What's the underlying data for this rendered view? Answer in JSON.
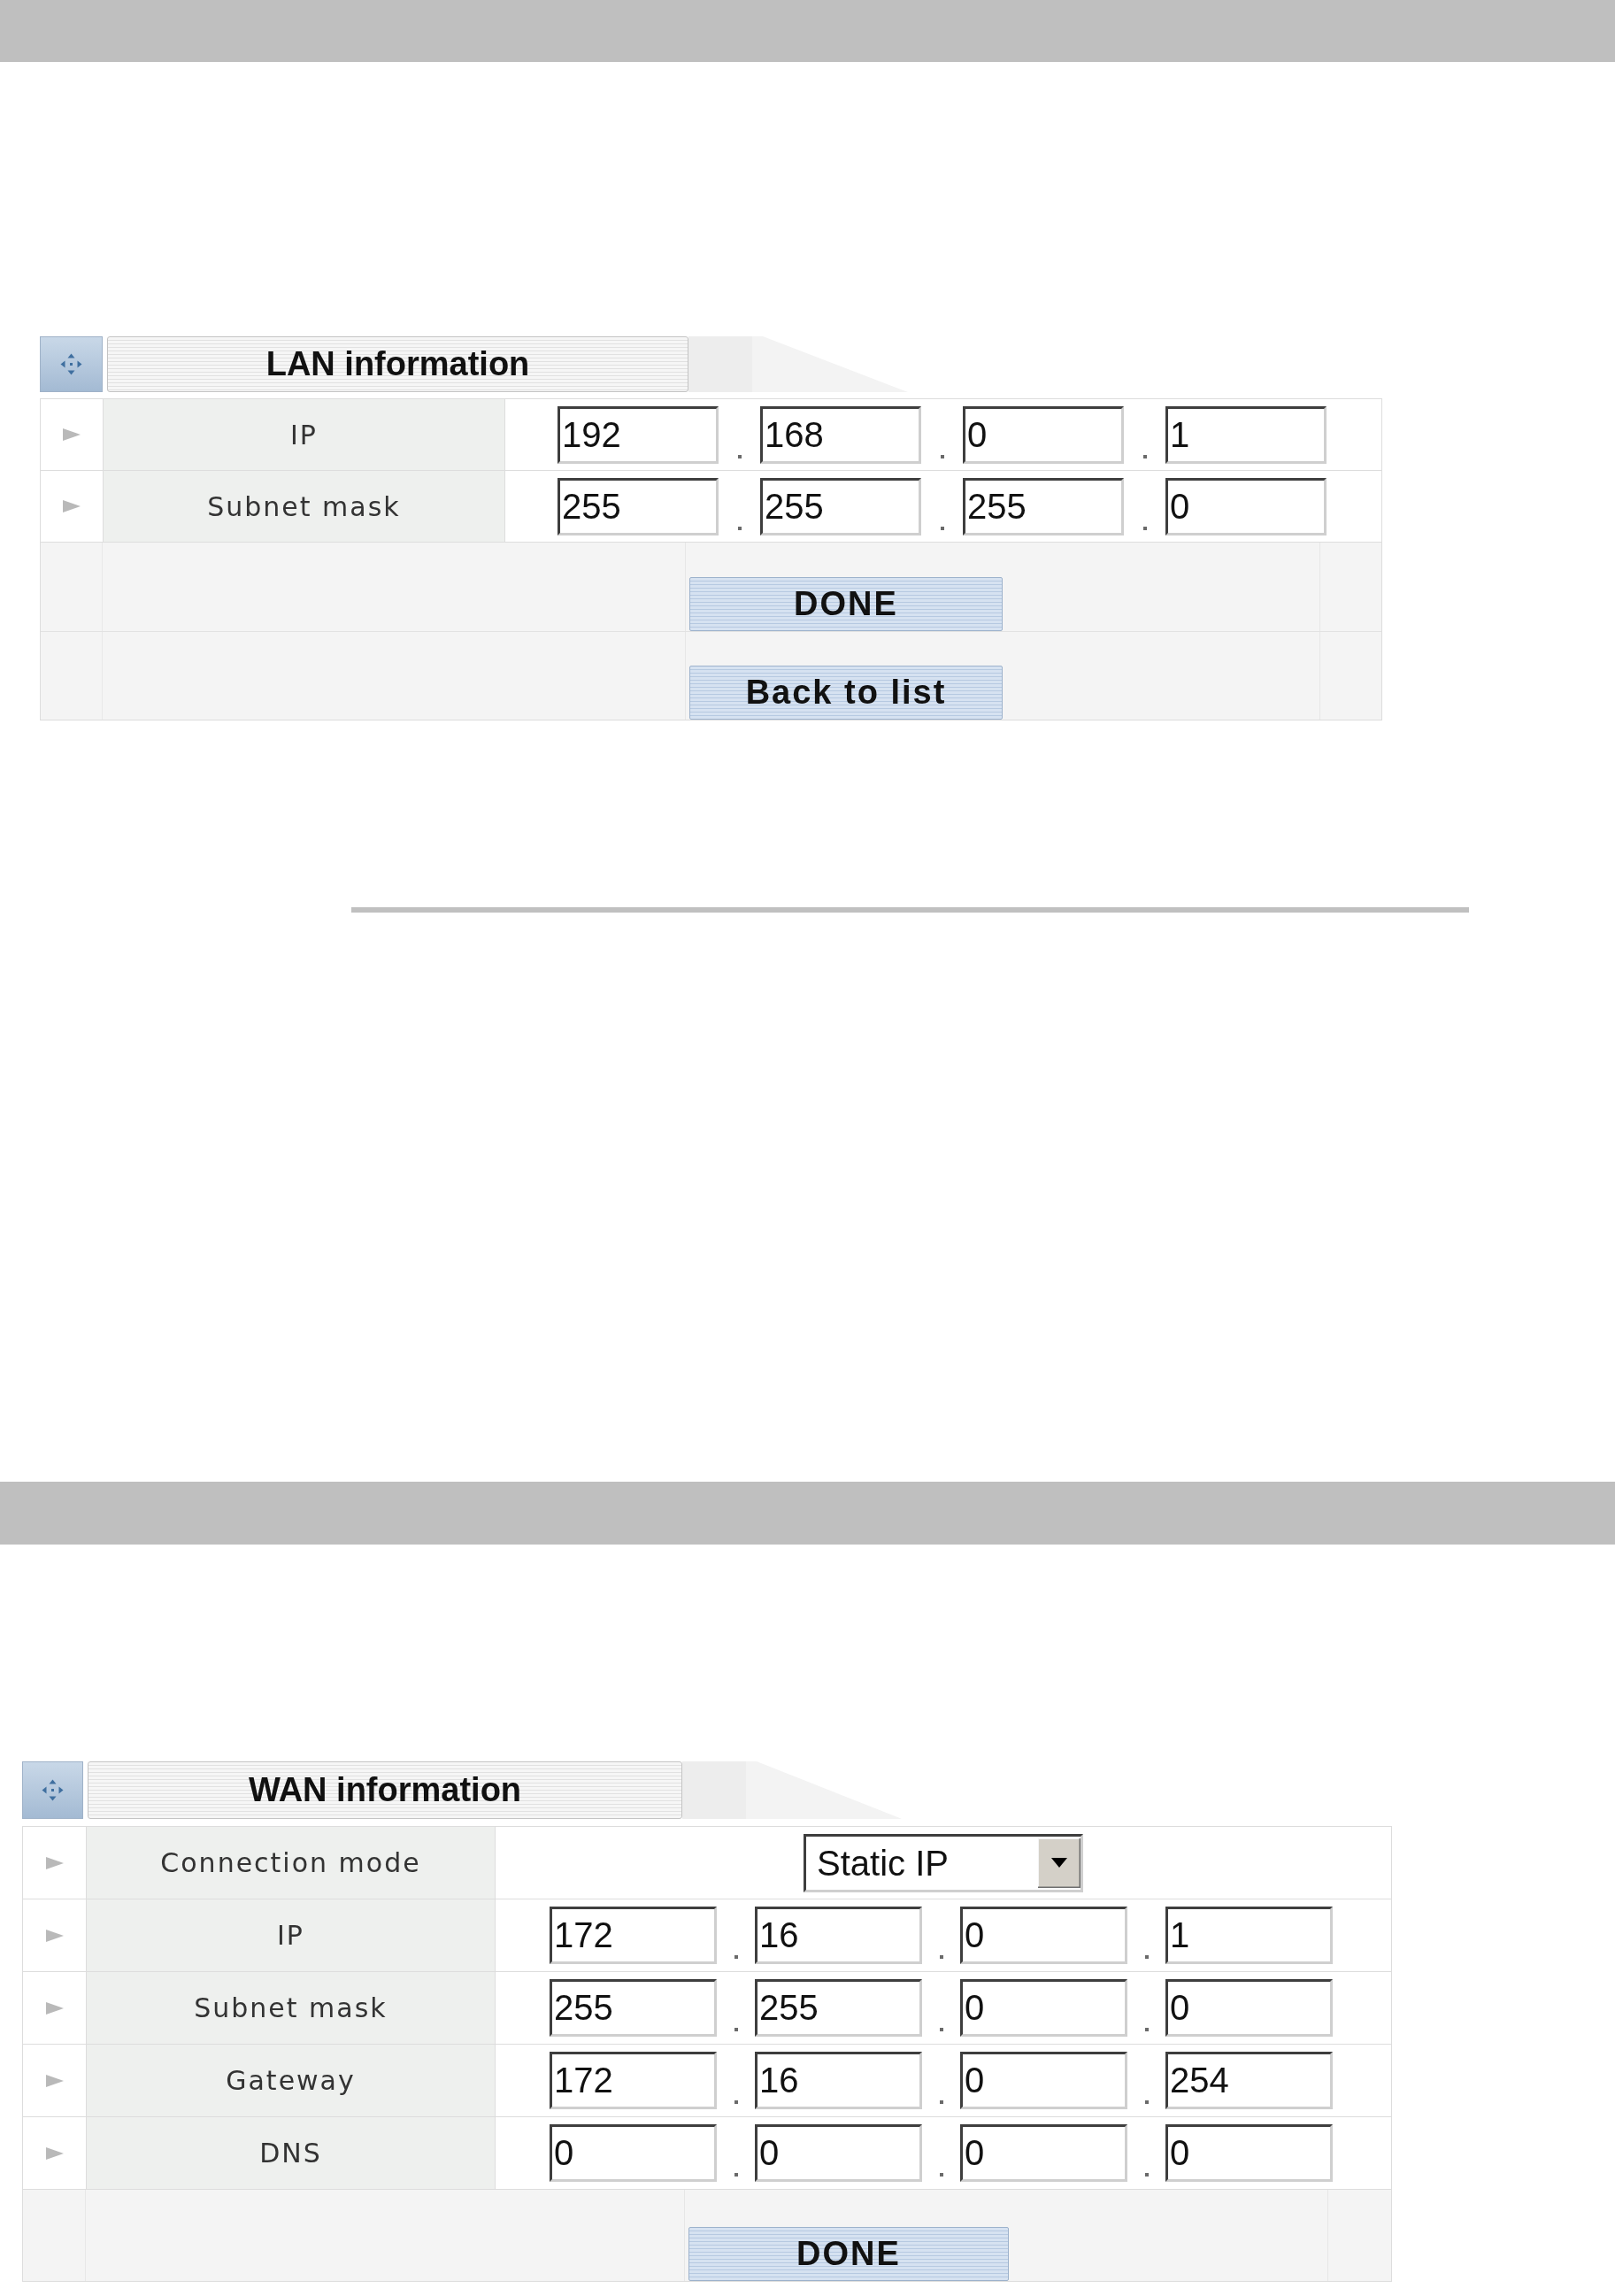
{
  "sections": [
    {
      "title": "LAN information",
      "rows": [
        {
          "kind": "address",
          "label": "IP",
          "octets": [
            "192",
            "168",
            "0",
            "1"
          ]
        },
        {
          "kind": "address",
          "label": "Subnet mask",
          "octets": [
            "255",
            "255",
            "255",
            "0"
          ]
        }
      ],
      "buttons": [
        "DONE",
        "Back to list"
      ]
    },
    {
      "title": "WAN information",
      "rows": [
        {
          "kind": "select",
          "label": "Connection mode",
          "value": "Static IP"
        },
        {
          "kind": "address",
          "label": "IP",
          "octets": [
            "172",
            "16",
            "0",
            "1"
          ]
        },
        {
          "kind": "address",
          "label": "Subnet mask",
          "octets": [
            "255",
            "255",
            "0",
            "0"
          ]
        },
        {
          "kind": "address",
          "label": "Gateway",
          "octets": [
            "172",
            "16",
            "0",
            "254"
          ]
        },
        {
          "kind": "address",
          "label": "DNS",
          "octets": [
            "0",
            "0",
            "0",
            "0"
          ]
        }
      ],
      "buttons": [
        "DONE"
      ]
    }
  ]
}
